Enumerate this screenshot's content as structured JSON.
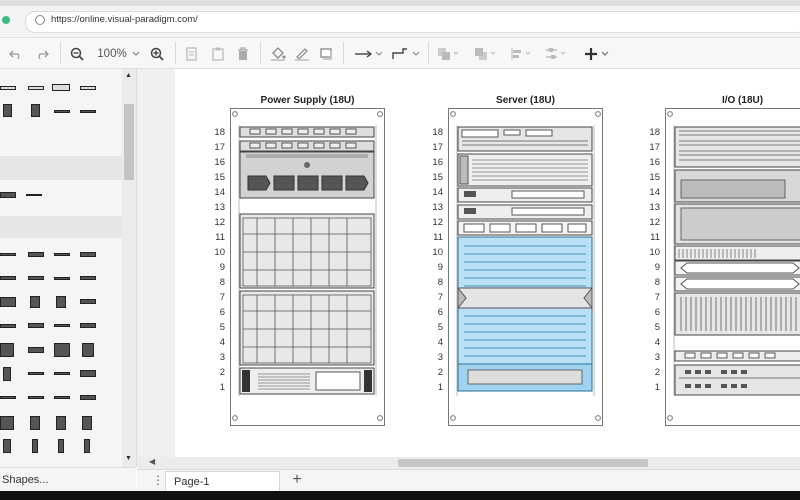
{
  "browser": {
    "url": "https://online.visual-paradigm.com/"
  },
  "toolbar": {
    "zoom": "100%",
    "undo_icon": "undo-icon",
    "redo_icon": "redo-icon",
    "zoom_out_icon": "zoom-out-icon",
    "zoom_in_icon": "zoom-in-icon"
  },
  "sidebar": {
    "more_shapes_label": "Shapes..."
  },
  "footer": {
    "page_tab_label": "Page-1"
  },
  "diagram": {
    "racks": [
      {
        "title": "Power Supply (18U)"
      },
      {
        "title": "Server (18U)"
      },
      {
        "title": "I/O (18U)"
      }
    ],
    "units": [
      "18",
      "17",
      "16",
      "15",
      "14",
      "13",
      "12",
      "11",
      "10",
      "9",
      "8",
      "7",
      "6",
      "5",
      "4",
      "3",
      "2",
      "1"
    ]
  },
  "colors": {
    "accent_green": "#3cba84",
    "server_blue": "#b9e0f5"
  }
}
